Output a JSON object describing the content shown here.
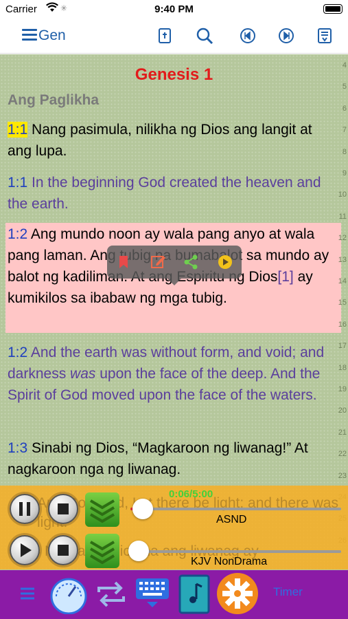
{
  "status_bar": {
    "carrier": "Carrier",
    "time": "9:40 PM"
  },
  "nav": {
    "book_label": "Gen",
    "icons": [
      "menu-icon",
      "bible-book-icon",
      "search-icon",
      "previous-chapter-icon",
      "next-chapter-icon",
      "save-icon"
    ]
  },
  "reader": {
    "chapter_title": "Genesis 1",
    "section_title": "Ang Paglikha",
    "verses": [
      {
        "ref": "1:1",
        "text": " Nang pasimula, nilikha ng Dios ang langit at ang lupa.",
        "lang": "tl",
        "highlight": "yellow"
      },
      {
        "ref": "1:1",
        "text": " In the beginning God created the heaven and the earth.",
        "lang": "en"
      },
      {
        "ref": "1:2",
        "text_before": " Ang mundo noon ay wala pang anyo at wala pang laman. Ang tubig na bumabalot sa mundo ay balot ng kadiliman. At ang Espiritu ng Dios",
        "footnote": "[1]",
        "text_after": " ay kumikilos sa ibabaw ng mga tubig.",
        "lang": "tl",
        "highlight": "pink"
      },
      {
        "ref": "1:2",
        "text_before": " And the earth was without form, and void; and darkness ",
        "italic": "was",
        "text_after": " upon the face of the deep. And the Spirit of God moved upon the face of the waters.",
        "lang": "en"
      },
      {
        "ref": "1:3",
        "text": " Sinabi ng Dios, “Magkaroon ng liwanag!” At nagkaroon nga ng liwanag.",
        "lang": "tl"
      }
    ],
    "line_numbers": [
      "4",
      "5",
      "6",
      "7",
      "8",
      "9",
      "10",
      "11",
      "12",
      "13",
      "14",
      "15",
      "16",
      "17",
      "18",
      "19",
      "20",
      "21",
      "22",
      "23",
      "24",
      "25",
      "26"
    ]
  },
  "popup": {
    "icons": [
      "bookmark-icon",
      "edit-note-icon",
      "share-icon",
      "play-verse-icon"
    ]
  },
  "player": {
    "time": "0:06/5:00",
    "track1_label": "ASND",
    "track2_label": "KJV NonDrama",
    "track1_progress": 0.06,
    "track2_progress": 0.04,
    "ghost_text_1": "And God said, Let there be light: and there was light.",
    "ghost_text_2": "1:4 Nakita ng Dios na ang liwanag ay",
    "colors": {
      "bar": "#f5af28",
      "time": "#42d13c"
    }
  },
  "tabbar": {
    "icons": [
      "list-icon",
      "speedometer-icon",
      "repeat-icon",
      "keyboard-icon",
      "music-book-icon",
      "settings-gear-icon"
    ],
    "timer_label": "Timer",
    "color": "#8b1ba6"
  }
}
